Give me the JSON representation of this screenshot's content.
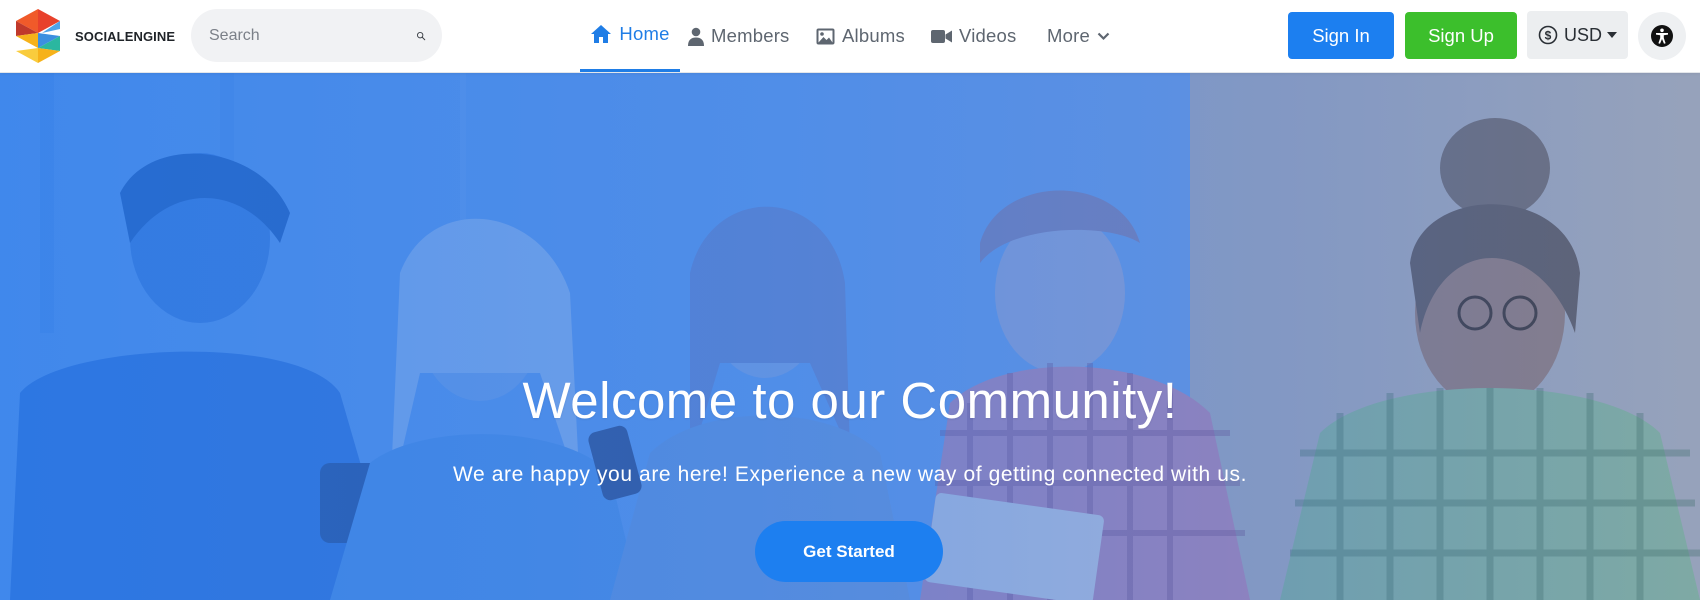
{
  "brand": {
    "name": "SOCIALENGINE",
    "logo_colors": [
      "#e8412c",
      "#f6b21a",
      "#3c8fe0",
      "#2bb7a0"
    ]
  },
  "search": {
    "placeholder": "Search",
    "icon": "search-icon"
  },
  "nav": {
    "items": [
      {
        "label": "Home",
        "icon": "home-icon",
        "active": true
      },
      {
        "label": "Members",
        "icon": "user-icon",
        "active": false
      },
      {
        "label": "Albums",
        "icon": "image-icon",
        "active": false
      },
      {
        "label": "Videos",
        "icon": "video-icon",
        "active": false
      },
      {
        "label": "More",
        "icon": "chevron-down-icon",
        "active": false
      }
    ]
  },
  "header_actions": {
    "sign_in": "Sign In",
    "sign_up": "Sign Up",
    "currency": "USD",
    "accessibility_icon": "accessibility-icon"
  },
  "hero": {
    "title": "Welcome to our Community!",
    "subtitle": "We are happy you are here! Experience a new way of getting connected with us.",
    "cta": "Get Started"
  },
  "colors": {
    "accent": "#1f7de6",
    "sign_in_bg": "#1c7ff0",
    "sign_up_bg": "#3cbf2c",
    "nav_text": "#5e6670"
  }
}
